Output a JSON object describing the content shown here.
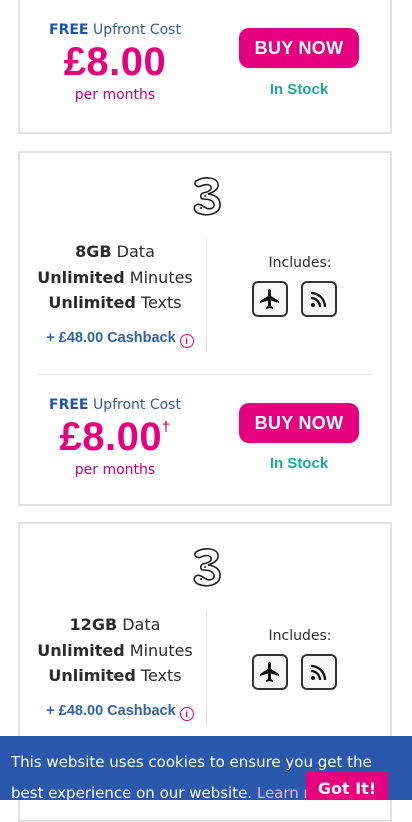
{
  "offers": [
    {
      "upfront_prefix": "FREE",
      "upfront_label": "Upfront Cost",
      "price": "£8.00",
      "price_mark": "",
      "per": "per months",
      "buy_label": "BUY NOW",
      "stock": "In Stock"
    },
    {
      "data_amount": "8GB",
      "data_label": "Data",
      "minutes_strong": "Unlimited",
      "minutes_label": "Minutes",
      "texts_strong": "Unlimited",
      "texts_label": "Texts",
      "cashback": "+ £48.00 Cashback",
      "info_glyph": "i",
      "includes": "Includes:",
      "features": [
        "airplane-icon",
        "wifi-icon"
      ],
      "upfront_prefix": "FREE",
      "upfront_label": "Upfront Cost",
      "price": "£8.00",
      "price_mark": "†",
      "per": "per months",
      "buy_label": "BUY NOW",
      "stock": "In Stock"
    },
    {
      "data_amount": "12GB",
      "data_label": "Data",
      "minutes_strong": "Unlimited",
      "minutes_label": "Minutes",
      "texts_strong": "Unlimited",
      "texts_label": "Texts",
      "cashback": "+ £48.00 Cashback",
      "info_glyph": "i",
      "includes": "Includes:",
      "features": [
        "airplane-icon",
        "wifi-icon"
      ]
    }
  ],
  "cookie": {
    "message": "This website uses cookies to ensure you get the best experience on our website.",
    "link": "Learn more",
    "button": "Got It!"
  },
  "colors": {
    "brand_pink": "#e6007e",
    "link_blue": "#2d63b0",
    "stock_teal": "#1ba99a",
    "cookie_bg": "#2a58ad"
  }
}
